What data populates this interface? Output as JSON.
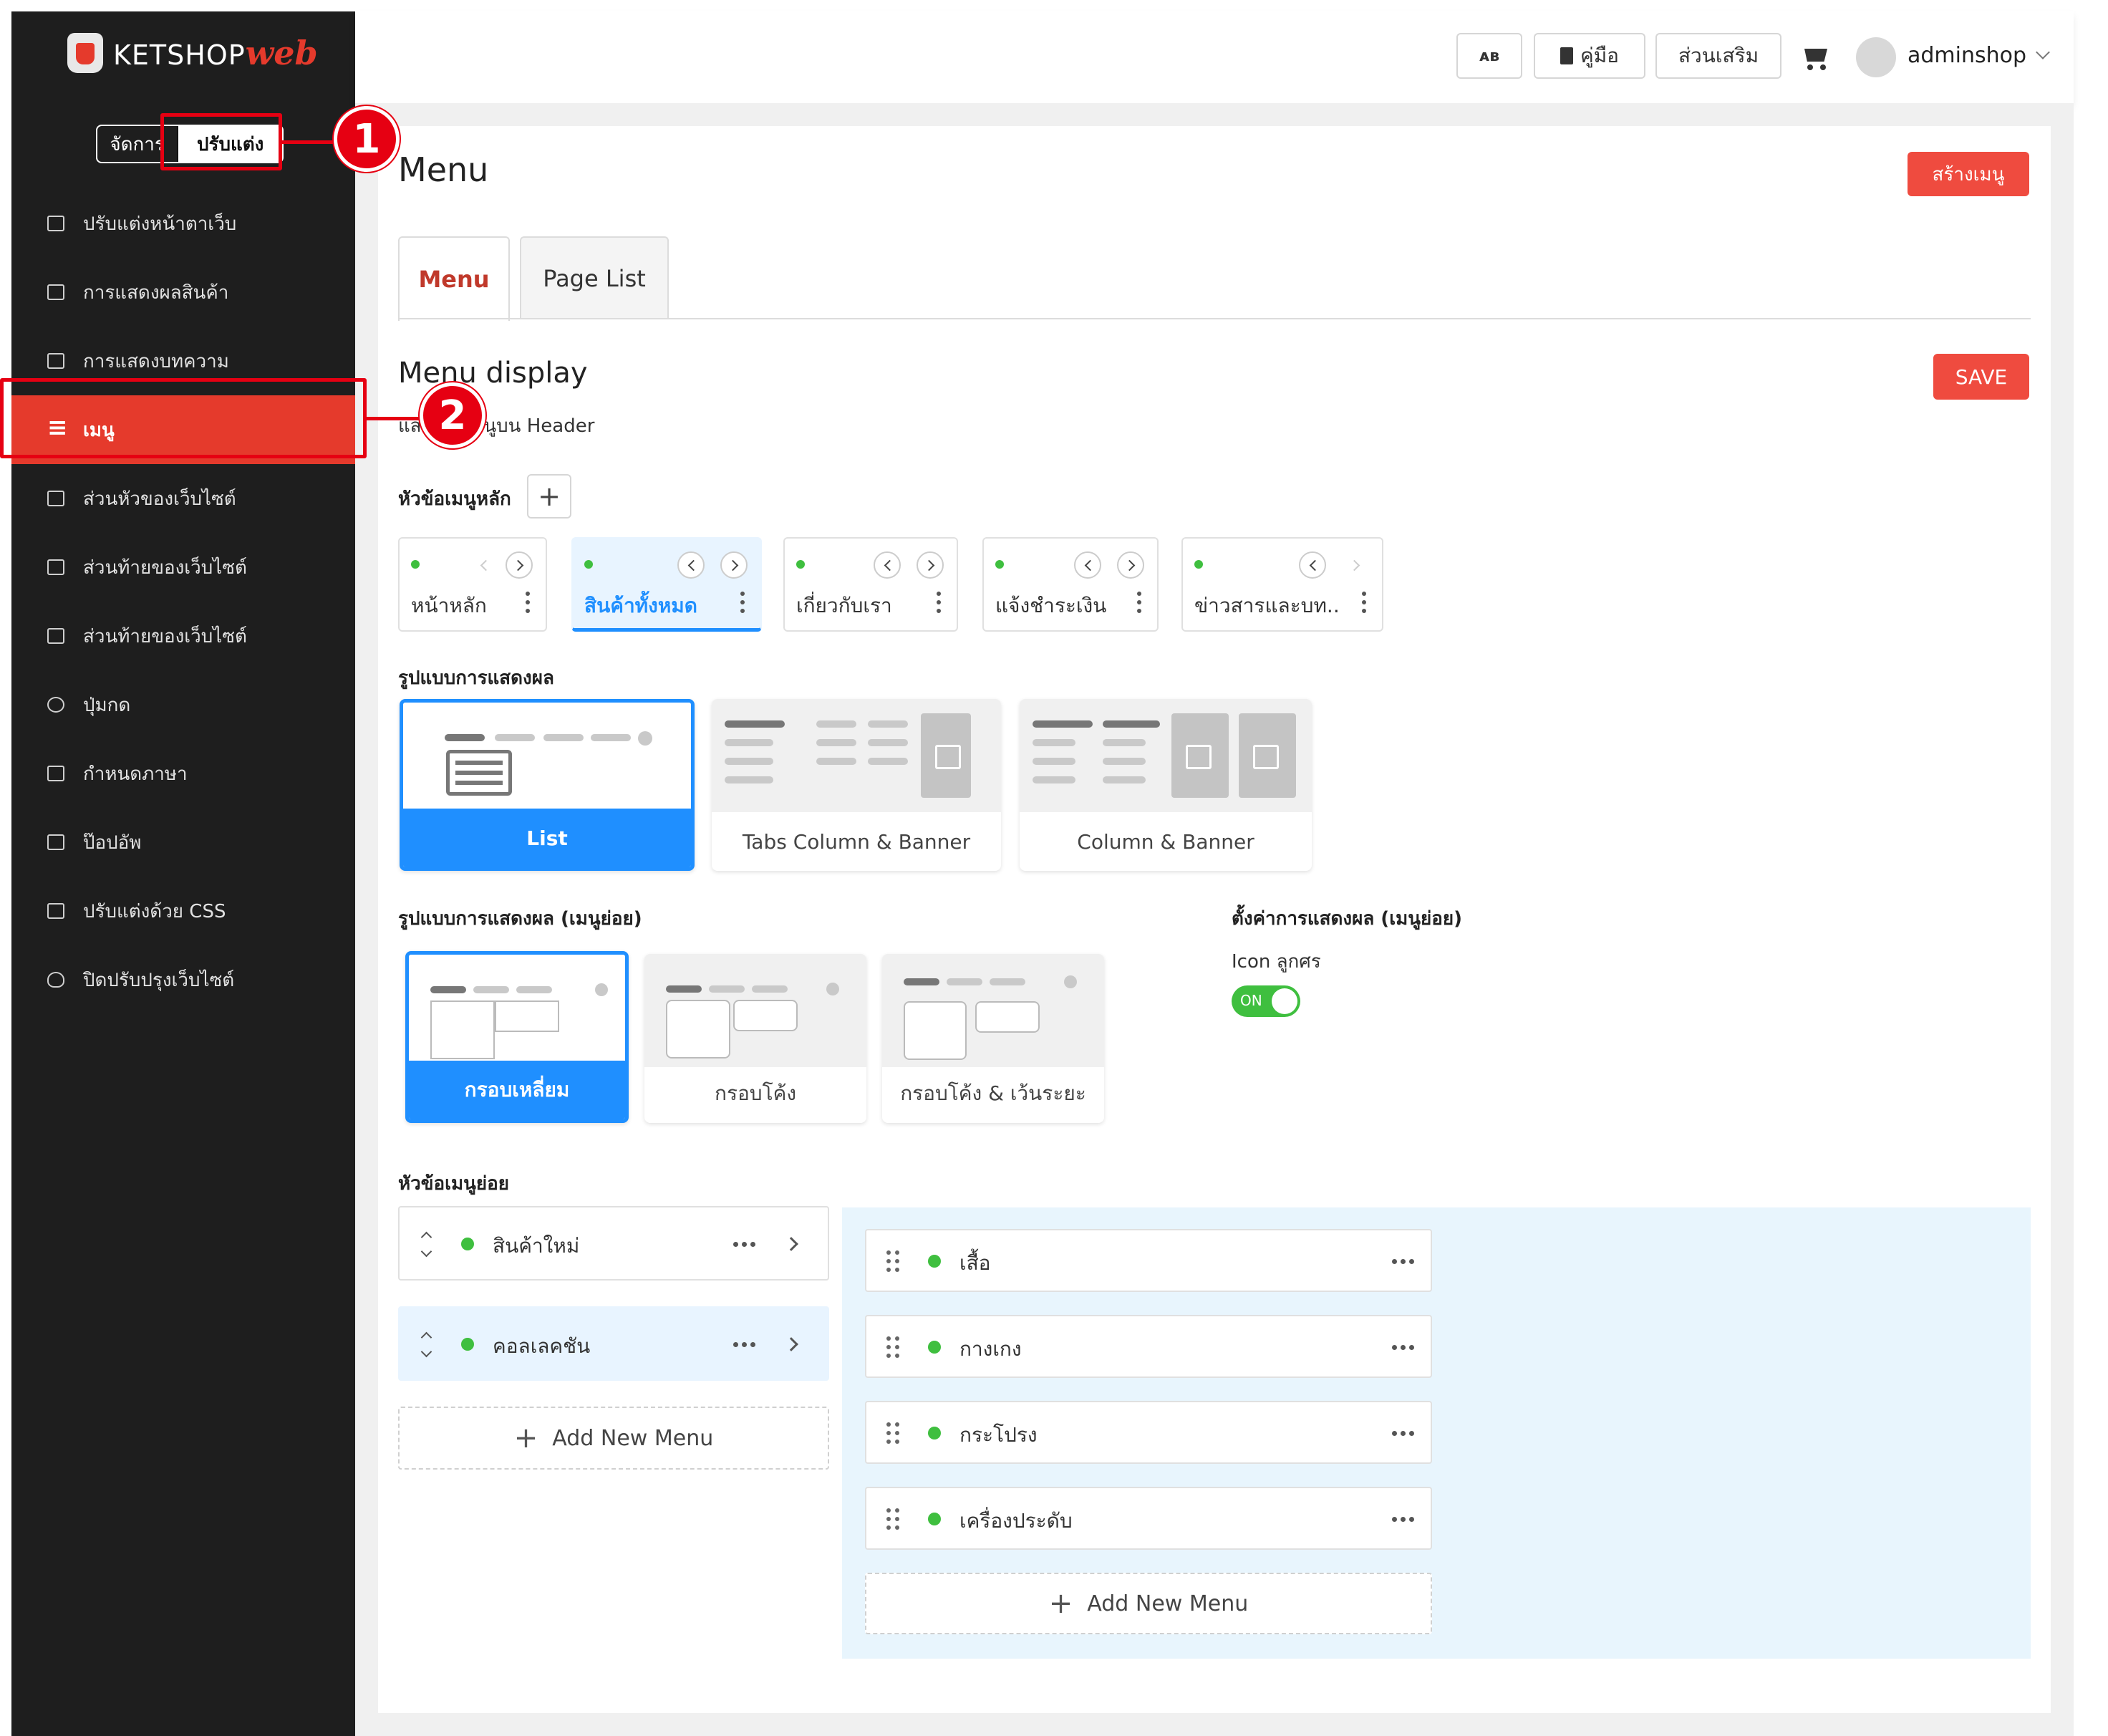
{
  "app": {
    "logo_main": "KETSHOP",
    "logo_accent": "web",
    "mode_manage": "จัดการ",
    "mode_customize": "ปรับแต่ง"
  },
  "sidebar": {
    "items": [
      {
        "label": "ปรับแต่งหน้าตาเว็บ",
        "icon": "layout-icon"
      },
      {
        "label": "การแสดงผลสินค้า",
        "icon": "grid-icon"
      },
      {
        "label": "การแสดงบทความ",
        "icon": "article-icon"
      },
      {
        "label": "เมนู",
        "icon": "menu-icon",
        "active": true
      },
      {
        "label": "ส่วนหัวของเว็บไซต์",
        "icon": "header-icon"
      },
      {
        "label": "ส่วนท้ายของเว็บไซต์",
        "icon": "footer-icon"
      },
      {
        "label": "ส่วนท้ายของเว็บไซต์",
        "icon": "sidebar-icon"
      },
      {
        "label": "ปุ่มกด",
        "icon": "toggle-icon"
      },
      {
        "label": "กำหนดภาษา",
        "icon": "language-icon"
      },
      {
        "label": "ป๊อปอัพ",
        "icon": "popup-icon"
      },
      {
        "label": "ปรับแต่งด้วย CSS",
        "icon": "css-icon"
      },
      {
        "label": "ปิดปรับปรุงเว็บไซต์",
        "icon": "bug-icon"
      }
    ]
  },
  "annotations": {
    "one": "1",
    "two": "2"
  },
  "topbar": {
    "lang_label": "ᴀʙ",
    "manual_label": "คู่มือ",
    "addons_label": "ส่วนเสริม",
    "username": "adminshop"
  },
  "page": {
    "title": "Menu",
    "create_button": "สร้างเมนู",
    "tabs": [
      "Menu",
      "Page List"
    ],
    "section_title": "Menu display",
    "section_subtitle": "แสดงผลเมนูบน Header",
    "save_button": "SAVE",
    "main_menu_label": "หัวข้อเมนูหลัก",
    "main_menus": [
      {
        "name": "หน้าหลัก",
        "selected": false
      },
      {
        "name": "สินค้าทั้งหมด",
        "selected": true
      },
      {
        "name": "เกี่ยวกับเรา",
        "selected": false
      },
      {
        "name": "แจ้งชำระเงิน",
        "selected": false
      },
      {
        "name": "ข่าวสารและบท..",
        "selected": false
      }
    ],
    "display_style_label": "รูปแบบการแสดงผล",
    "display_styles": [
      {
        "name": "List",
        "selected": true
      },
      {
        "name": "Tabs Column & Banner",
        "selected": false
      },
      {
        "name": "Column & Banner",
        "selected": false
      }
    ],
    "submenu_style_label": "รูปแบบการแสดงผล (เมนูย่อย)",
    "submenu_styles": [
      {
        "name": "กรอบเหลี่ยม",
        "selected": true
      },
      {
        "name": "กรอบโค้ง",
        "selected": false
      },
      {
        "name": "กรอบโค้ง & เว้นระยะ",
        "selected": false
      }
    ],
    "submenu_settings_label": "ตั้งค่าการแสดงผล (เมนูย่อย)",
    "arrow_icon_label": "Icon ลูกศร",
    "toggle_state": "ON",
    "submenu_label": "หัวข้อเมนูย่อย",
    "submenus": [
      {
        "name": "สินค้าใหม่",
        "selected": false
      },
      {
        "name": "คอลเลคชัน",
        "selected": true
      }
    ],
    "add_new_menu": "Add New Menu",
    "children": [
      "เสื้อ",
      "กางเกง",
      "กระโปรง",
      "เครื่องประดับ"
    ]
  },
  "colors": {
    "accent_red": "#e53a2c",
    "button_red": "#ef4b3f",
    "selected_blue": "#1f8fff",
    "status_green": "#3fbf3f",
    "sidebar_bg": "#1e1e1e"
  }
}
